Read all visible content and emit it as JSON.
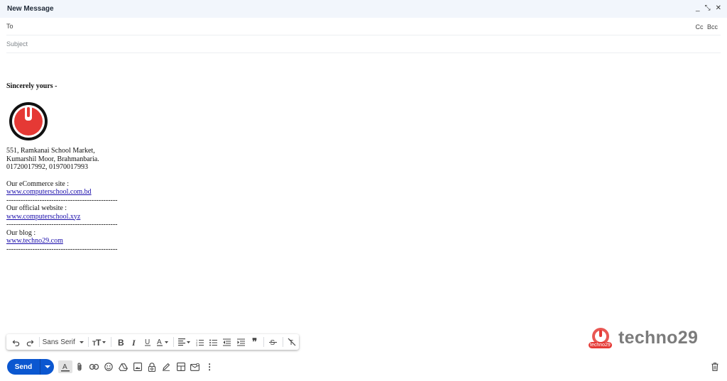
{
  "window": {
    "title": "New Message",
    "minimize_glyph": "_",
    "popout_glyph": "⤡",
    "close_glyph": "✕"
  },
  "to_field": {
    "label": "To",
    "cc": "Cc",
    "bcc": "Bcc"
  },
  "subject_field": {
    "placeholder": "Subject"
  },
  "signature": {
    "closing": "Sincerely yours -",
    "address": [
      "551, Ramkanai School Market,",
      "Kumarshil Moor, Brahmanbaria.",
      "01720017992, 01970017993"
    ],
    "ecommerce_label": "Our eCommerce site :",
    "ecommerce_link": "www.computerschool.com.bd",
    "divider_1": "-----------------------------------------------",
    "official_label": "Our official website :",
    "official_link": "www.computerschool.xyz",
    "divider_2": "-----------------------------------------------",
    "blog_label": "Our blog :",
    "blog_link": "www.techno29.com",
    "divider_3": "-----------------------------------------------"
  },
  "format_bar": {
    "font_name": "Sans Serif",
    "quote_glyph": "❞"
  },
  "actions": {
    "send_label": "Send",
    "more_glyph": "⋮"
  },
  "watermark": {
    "text": "techno29",
    "sub": "techno29"
  },
  "colors": {
    "accent": "#0b57d0",
    "logo_red": "#e53935",
    "link": "#1a0dab"
  }
}
